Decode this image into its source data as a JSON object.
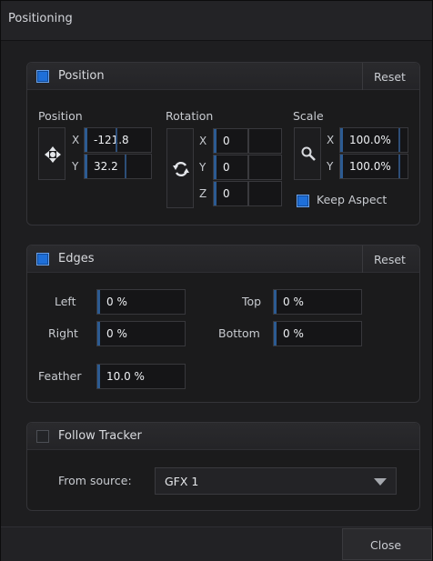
{
  "window": {
    "title": "Positioning"
  },
  "position_panel": {
    "enabled": true,
    "title": "Position",
    "reset_label": "Reset",
    "position": {
      "label": "Position",
      "x_axis": "X",
      "y_axis": "Y",
      "x_value": "-121.8",
      "y_value": "32.2"
    },
    "rotation": {
      "label": "Rotation",
      "x_axis": "X",
      "y_axis": "Y",
      "z_axis": "Z",
      "x_value": "0",
      "y_value": "0",
      "z_value": "0"
    },
    "scale": {
      "label": "Scale",
      "x_axis": "X",
      "y_axis": "Y",
      "x_value": "100.0%",
      "y_value": "100.0%"
    },
    "keep_aspect": {
      "checked": true,
      "label": "Keep Aspect"
    }
  },
  "edges_panel": {
    "enabled": true,
    "title": "Edges",
    "reset_label": "Reset",
    "left": {
      "label": "Left",
      "value": "0 %"
    },
    "top": {
      "label": "Top",
      "value": "0 %"
    },
    "right": {
      "label": "Right",
      "value": "0 %"
    },
    "bottom": {
      "label": "Bottom",
      "value": "0 %"
    },
    "feather": {
      "label": "Feather",
      "value": "10.0 %"
    }
  },
  "tracker_panel": {
    "enabled": false,
    "title": "Follow Tracker",
    "source_label": "From source:",
    "source_value": "GFX 1"
  },
  "footer": {
    "close_label": "Close"
  },
  "colors": {
    "accent": "#1e6fd9",
    "background": "#1e1e20",
    "field_bg": "#151517"
  }
}
